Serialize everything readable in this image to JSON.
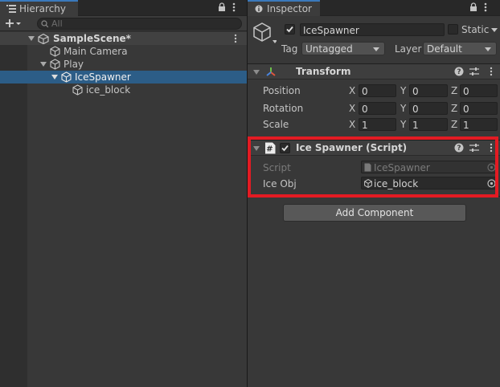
{
  "hierarchy": {
    "tab_label": "Hierarchy",
    "search_placeholder": "All",
    "scene_name": "SampleScene*",
    "items": [
      {
        "label": "Main Camera"
      },
      {
        "label": "Play"
      },
      {
        "label": "IceSpawner"
      },
      {
        "label": "ice_block"
      }
    ]
  },
  "inspector": {
    "tab_label": "Inspector",
    "object_name": "IceSpawner",
    "static_label": "Static",
    "tag_label": "Tag",
    "tag_value": "Untagged",
    "layer_label": "Layer",
    "layer_value": "Default",
    "transform": {
      "title": "Transform",
      "rows": [
        {
          "label": "Position",
          "x": "0",
          "y": "0",
          "z": "0"
        },
        {
          "label": "Rotation",
          "x": "0",
          "y": "0",
          "z": "0"
        },
        {
          "label": "Scale",
          "x": "1",
          "y": "1",
          "z": "1"
        }
      ],
      "axis_x": "X",
      "axis_y": "Y",
      "axis_z": "Z"
    },
    "script_component": {
      "title": "Ice Spawner (Script)",
      "script_label": "Script",
      "script_value": "IceSpawner",
      "ice_obj_label": "Ice Obj",
      "ice_obj_value": "ice_block"
    },
    "add_component_label": "Add Component"
  },
  "colors": {
    "selection": "#2c5d87",
    "tab_accent": "#3a79bb",
    "highlight_box": "#e31b23"
  }
}
